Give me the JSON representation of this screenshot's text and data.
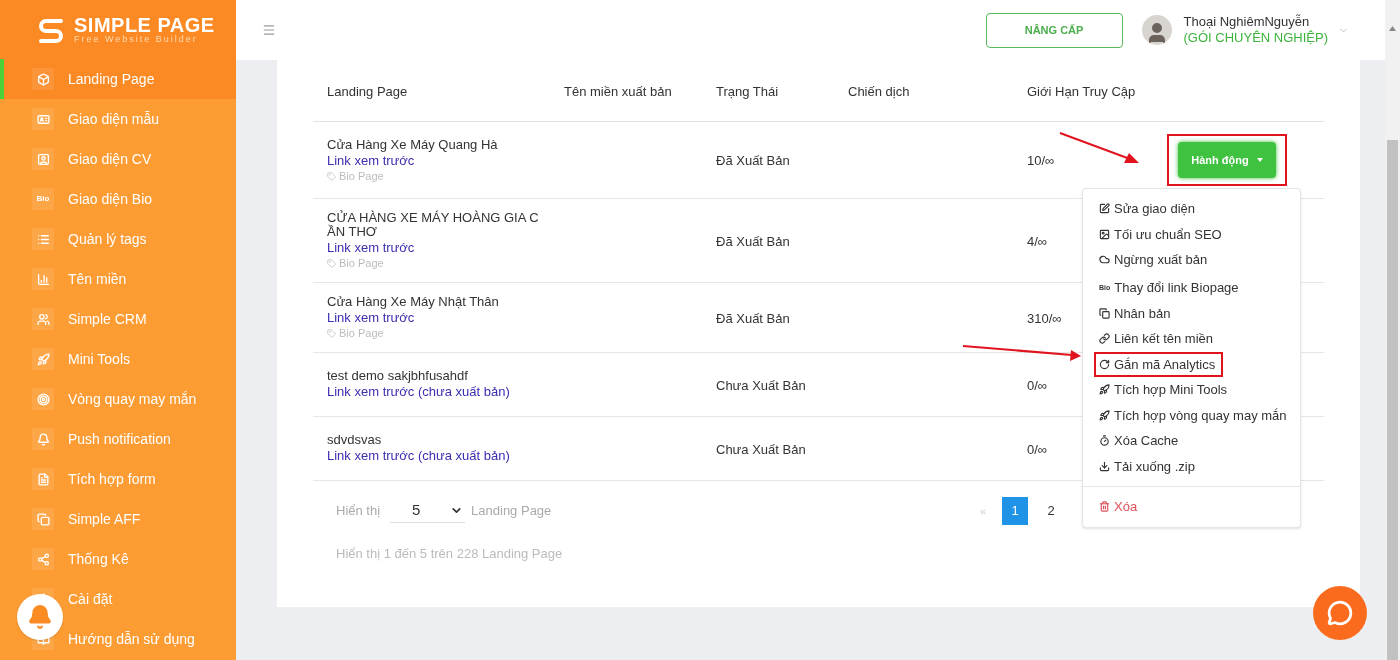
{
  "sidebar": {
    "logo": {
      "title": "SIMPLE PAGE",
      "subtitle": "Free Website Builder"
    },
    "items": [
      {
        "label": "Landing Page",
        "selected": true
      },
      {
        "label": "Giao diện mẫu",
        "selected": false
      },
      {
        "label": "Giao diện CV",
        "selected": false
      },
      {
        "label": "Giao diện Bio",
        "selected": false,
        "icon_text": "Bio"
      },
      {
        "label": "Quản lý tags",
        "selected": false
      },
      {
        "label": "Tên miền",
        "selected": false
      },
      {
        "label": "Simple CRM",
        "selected": false
      },
      {
        "label": "Mini Tools",
        "selected": false
      },
      {
        "label": "Vòng quay may mắn",
        "selected": false
      },
      {
        "label": "Push notification",
        "selected": false
      },
      {
        "label": "Tích hợp form",
        "selected": false
      },
      {
        "label": "Simple AFF",
        "selected": false
      },
      {
        "label": "Thống Kê",
        "selected": false
      },
      {
        "label": "Cài đặt",
        "selected": false
      },
      {
        "label": "Hướng dẫn sử dụng",
        "selected": false
      }
    ]
  },
  "header": {
    "upgrade_button": "NÂNG CẤP",
    "user": {
      "name": "Thoại NghiêmNguyễn",
      "plan": "(GÓI CHUYÊN NGHIỆP)"
    }
  },
  "table": {
    "columns": [
      "Landing Page",
      "Tên miền xuất bản",
      "Trạng Thái",
      "Chiến dịch",
      "Giới Hạn Truy Cập"
    ],
    "rows": [
      {
        "name": "Cửa Hàng Xe Máy Quang Hà",
        "preview_link": "Link xem trước",
        "tag": "Bio Page",
        "status": "Đã Xuất Bản",
        "limit": "10/∞"
      },
      {
        "name": "CỬA HÀNG XE MÁY HOÀNG GIA CẦN THƠ",
        "preview_link": "Link xem trước",
        "tag": "Bio Page",
        "status": "Đã Xuất Bản",
        "limit": "4/∞"
      },
      {
        "name": "Cửa Hàng Xe Máy Nhật Thân",
        "preview_link": "Link xem trước",
        "tag": "Bio Page",
        "status": "Đã Xuất Bản",
        "limit": "310/∞"
      },
      {
        "name": "test demo sakjbhfusahdf",
        "preview_link": "Link xem trước (chưa xuất bản)",
        "status": "Chưa Xuất Bản",
        "limit": "0/∞"
      },
      {
        "name": "sdvdsvas",
        "preview_link": "Link xem trước (chưa xuất bản)",
        "status": "Chưa Xuất Bản",
        "limit": "0/∞"
      }
    ]
  },
  "action_button": {
    "label": "Hành động",
    "expanded": true,
    "highlighted": true
  },
  "action_menu": [
    {
      "label": "Sửa giao diện",
      "kind": "normal",
      "highlighted": false
    },
    {
      "label": "Tối ưu chuẩn SEO",
      "kind": "normal",
      "highlighted": false
    },
    {
      "label": "Ngừng xuất bản",
      "kind": "normal",
      "highlighted": false
    },
    {
      "label": "Thay đổi link Biopage",
      "kind": "normal",
      "highlighted": false,
      "icon_text": "Bio"
    },
    {
      "label": "Nhân bản",
      "kind": "normal",
      "highlighted": false
    },
    {
      "label": "Liên kết tên miền",
      "kind": "normal",
      "highlighted": false
    },
    {
      "label": "Gắn mã Analytics",
      "kind": "normal",
      "highlighted": true
    },
    {
      "label": "Tích hợp Mini Tools",
      "kind": "normal",
      "highlighted": false
    },
    {
      "label": "Tích hợp vòng quay may mắn",
      "kind": "normal",
      "highlighted": false
    },
    {
      "label": "Xóa Cache",
      "kind": "normal",
      "highlighted": false
    },
    {
      "label": "Tải xuống .zip",
      "kind": "normal",
      "highlighted": false
    },
    {
      "label": "Xóa",
      "kind": "danger",
      "highlighted": false
    }
  ],
  "pagination": {
    "show_label": "Hiển thị",
    "page_size": "5",
    "unit": "Landing Page",
    "prev": "«",
    "pages": [
      {
        "label": "1",
        "selected": true
      },
      {
        "label": "2",
        "selected": false
      }
    ],
    "summary": "Hiển thị 1 đến 5 trên 228 Landing Page"
  }
}
